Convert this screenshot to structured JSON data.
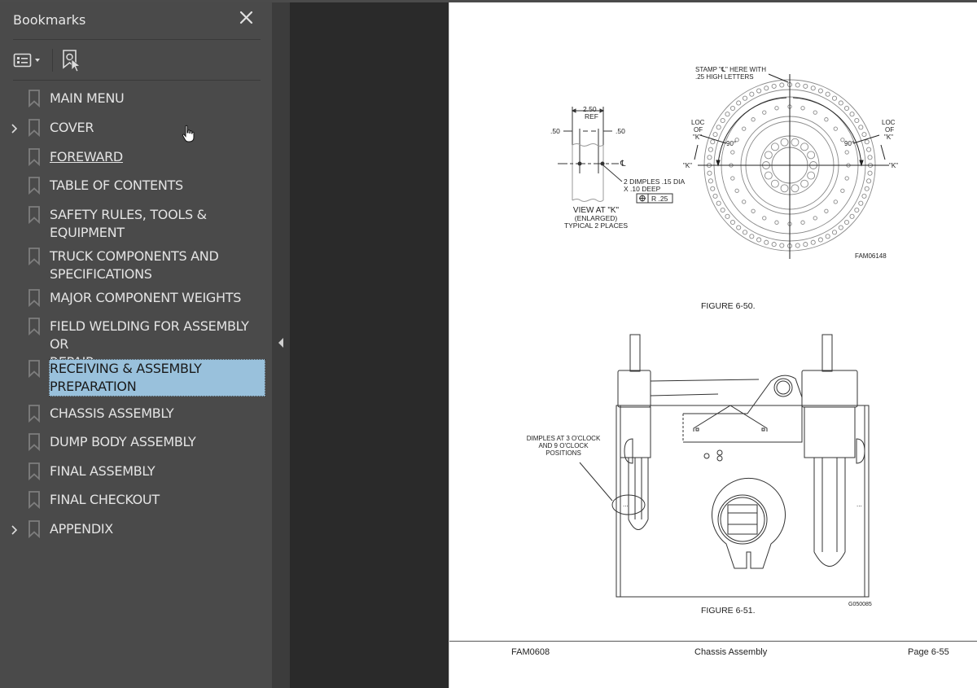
{
  "sidebar": {
    "title": "Bookmarks",
    "close_icon": "close-icon",
    "toolbar": {
      "options_icon": "list-options-icon",
      "dropdown_icon": "caret-down-icon",
      "find_bookmark_icon": "find-current-bookmark-icon"
    },
    "bookmarks": [
      {
        "label": "MAIN MENU",
        "expandable": false
      },
      {
        "label": "COVER",
        "expandable": true
      },
      {
        "label": "FOREWARD",
        "expandable": false,
        "hovered": true
      },
      {
        "label": "TABLE OF CONTENTS",
        "expandable": false
      },
      {
        "label": "SAFETY RULES, TOOLS & EQUIPMENT",
        "line1": "SAFETY RULES, TOOLS &",
        "line2": "EQUIPMENT",
        "expandable": false
      },
      {
        "label": "TRUCK COMPONENTS AND SPECIFICATIONS",
        "line1": "TRUCK COMPONENTS AND",
        "line2": "SPECIFICATIONS",
        "expandable": false
      },
      {
        "label": "MAJOR COMPONENT WEIGHTS",
        "expandable": false
      },
      {
        "label": "FIELD WELDING FOR ASSEMBLY OR REPAIR",
        "line1": "FIELD WELDING FOR ASSEMBLY OR",
        "line2": "REPAIR",
        "expandable": false
      },
      {
        "label": "RECEIVING & ASSEMBLY PREPARATION",
        "line1": "RECEIVING & ASSEMBLY",
        "line2": "PREPARATION",
        "expandable": false,
        "selected": true
      },
      {
        "label": "CHASSIS ASSEMBLY",
        "expandable": false
      },
      {
        "label": "DUMP BODY ASSEMBLY",
        "expandable": false
      },
      {
        "label": "FINAL ASSEMBLY",
        "expandable": false
      },
      {
        "label": "FINAL CHECKOUT",
        "expandable": false
      },
      {
        "label": "APPENDIX",
        "expandable": true
      }
    ],
    "collapse_icon": "collapse-panel-icon"
  },
  "document": {
    "figure_50": {
      "caption": "FIGURE 6-50.",
      "id_code": "FAM06148",
      "view_title": "VIEW AT \"K\"",
      "view_sub1": "(ENLARGED)",
      "view_sub2": "TYPICAL 2 PLACES",
      "dim_ref_value": "2.50",
      "dim_ref_label": "REF",
      "dim_left": ".50",
      "dim_right": ".50",
      "centerline_symbol": "℄",
      "dimples_note1": "2 DIMPLES .15 DIA",
      "dimples_note2": "X .10 DEEP",
      "tolerance_value": "R .25",
      "stamp_note1": "STAMP \"℄\" HERE WITH",
      "stamp_note2": ".25 HIGH LETTERS",
      "loc_label1": "LOC",
      "loc_label2": "OF",
      "loc_label3": "\"K\"",
      "k_label": "\"K\"",
      "angle_left": "90°",
      "angle_right": "90°"
    },
    "figure_51": {
      "caption": "FIGURE 6-51.",
      "id_code": "G050085",
      "note1": "DIMPLES AT 3 O'CLOCK",
      "note2": "AND 9 O'CLOCK",
      "note3": "POSITIONS",
      "dimple_marks": "..."
    },
    "footer": {
      "left": "FAM0608",
      "center": "Chassis Assembly",
      "right": "Page 6-55"
    }
  }
}
